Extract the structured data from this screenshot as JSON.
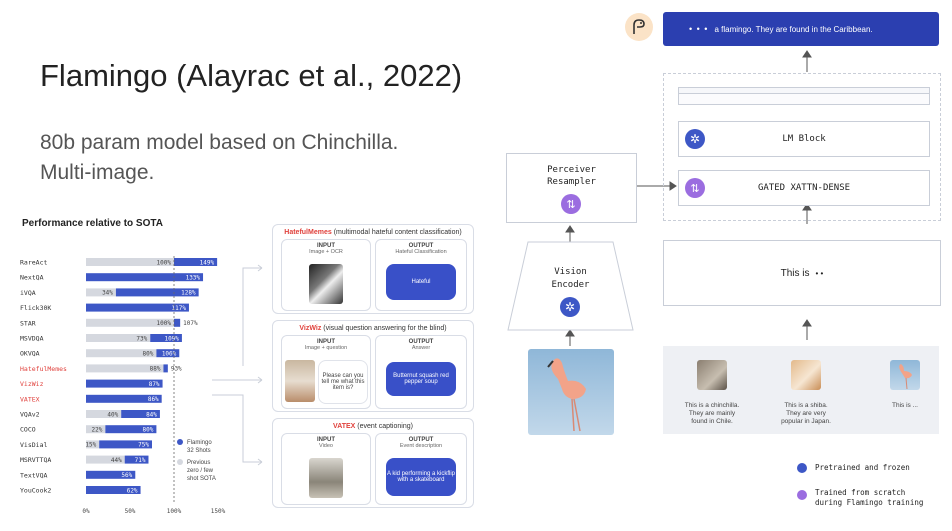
{
  "slide": {
    "title": "Flamingo (Alayrac et al., 2022)",
    "subtitle_line1": "80b param model based on Chinchilla.",
    "subtitle_line2": "Multi-image."
  },
  "colors": {
    "flamingo": "#3d57c6",
    "previous": "#d5d8df",
    "highlight": "#e0413c",
    "frozen": "#3d57c6",
    "trained": "#9b6de0"
  },
  "chart_data": {
    "type": "bar",
    "title": "Performance relative to SOTA",
    "categories": [
      "RareAct",
      "NextQA",
      "iVQA",
      "Flick30K",
      "STAR",
      "MSVDQA",
      "OKVQA",
      "HatefulMemes",
      "VizWiz",
      "VATEX",
      "VQAv2",
      "COCO",
      "VisDial",
      "MSRVTTQA",
      "TextVQA",
      "YouCook2"
    ],
    "highlighted": [
      "HatefulMemes",
      "VizWiz",
      "VATEX"
    ],
    "series": [
      {
        "name": "Flamingo 32 Shots",
        "values": [
          149,
          133,
          128,
          117,
          107,
          109,
          106,
          93,
          87,
          86,
          84,
          80,
          75,
          71,
          56,
          62
        ]
      },
      {
        "name": "Previous zero / few shot SOTA",
        "values": [
          100,
          null,
          34,
          null,
          100,
          73,
          80,
          88,
          null,
          null,
          40,
          22,
          15,
          44,
          null,
          null
        ]
      }
    ],
    "flamingo_labels": [
      "149%",
      "133%",
      "128%",
      "117%",
      "107%",
      "109%",
      "106%",
      "93%",
      "87%",
      "86%",
      "84%",
      "80%",
      "75%",
      "71%",
      "56%",
      "62%"
    ],
    "previous_labels": [
      "100%",
      "",
      "34%",
      "",
      "100%",
      "73%",
      "80%",
      "88%",
      "",
      "",
      "40%",
      "22%",
      "15%",
      "44%",
      "",
      ""
    ],
    "xticks": [
      "0%",
      "50%",
      "100%",
      "150%"
    ],
    "xlim": [
      0,
      160
    ],
    "legend": {
      "flamingo": [
        "Flamingo",
        "32 Shots"
      ],
      "previous": [
        "Previous",
        "zero / few",
        "shot SOTA"
      ]
    }
  },
  "examples": {
    "hateful": {
      "title_hl": "HatefulMemes",
      "title_rest": " (multimodal hateful content classification)",
      "input_label": "INPUT",
      "input_sub": "Image + OCR",
      "output_label": "OUTPUT",
      "output_sub": "Hateful Classification",
      "answer": "Hateful"
    },
    "vizwiz": {
      "title_hl": "VizWiz",
      "title_rest": " (visual question answering for the blind)",
      "input_label": "INPUT",
      "input_sub": "Image + question",
      "output_label": "OUTPUT",
      "output_sub": "Answer",
      "question": "Please can you tell me what this item is?",
      "answer": "Butternut squash red pepper soup"
    },
    "vatex": {
      "title_hl": "VATEX",
      "title_rest": " (event captioning)",
      "input_label": "INPUT",
      "input_sub": "Video",
      "output_label": "OUTPUT",
      "output_sub": "Event description",
      "answer": "A kid performing a kickflip with a skateboard"
    }
  },
  "architecture": {
    "output_text": "a flamingo. They are found in the Caribbean.",
    "output_dots": "• • •",
    "lm_block": "LM Block",
    "gated": "GATED XATTN-DENSE",
    "perceiver": [
      "Perceiver",
      "Resampler"
    ],
    "vision_encoder": [
      "Vision",
      "Encoder"
    ],
    "prompt": "This is",
    "prompt_dots": "• •",
    "examples": [
      {
        "caption": [
          "This is a chinchilla.",
          "They are mainly",
          "found in Chile."
        ]
      },
      {
        "caption": [
          "This is a shiba.",
          "They are very",
          "popular in Japan."
        ]
      },
      {
        "caption": [
          "This is ..."
        ]
      }
    ],
    "legend": {
      "frozen": "Pretrained and frozen",
      "trained_1": "Trained from scratch",
      "trained_2": "during Flamingo training"
    }
  }
}
